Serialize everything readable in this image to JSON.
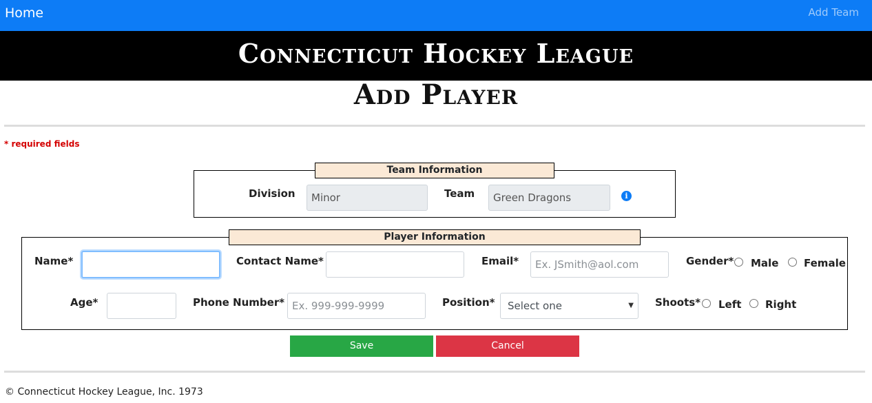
{
  "nav": {
    "home": "Home",
    "add_team": "Add Team"
  },
  "banner": {
    "title": "Connecticut Hockey League"
  },
  "page": {
    "title": "Add Player"
  },
  "required_note": "* required fields",
  "team_info": {
    "legend": "Team Information",
    "division_label": "Division",
    "division_value": "Minor",
    "team_label": "Team",
    "team_value": "Green Dragons"
  },
  "player_info": {
    "legend": "Player Information",
    "name_label": "Name*",
    "name_value": "",
    "contact_label": "Contact Name*",
    "contact_value": "",
    "email_label": "Email*",
    "email_placeholder": "Ex. JSmith@aol.com",
    "gender_label": "Gender*",
    "gender_options": [
      "Male",
      "Female"
    ],
    "age_label": "Age*",
    "age_value": "",
    "phone_label": "Phone Number*",
    "phone_placeholder": "Ex. 999-999-9999",
    "position_label": "Position*",
    "position_selected": "Select one",
    "shoots_label": "Shoots*",
    "shoots_options": [
      "Left",
      "Right"
    ]
  },
  "buttons": {
    "save": "Save",
    "cancel": "Cancel"
  },
  "footer": "© Connecticut Hockey League, Inc. 1973",
  "colors": {
    "navbar": "#0d7cf6",
    "save": "#28a745",
    "cancel": "#dc3545",
    "legend_bg": "#fbe9d6",
    "required": "#d40000"
  },
  "icons": {
    "team_info": "info-circle-icon",
    "select_caret": "chevron-down-icon"
  }
}
